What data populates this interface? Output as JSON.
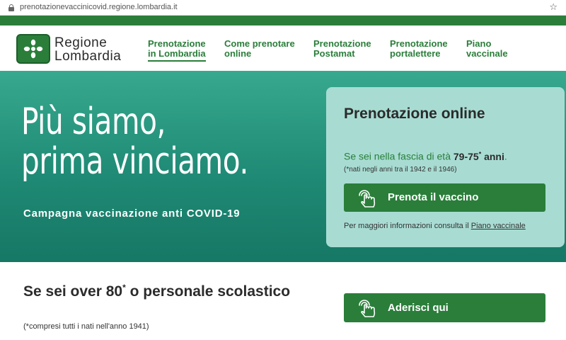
{
  "browser": {
    "url": "prenotazionevaccinicovid.regione.lombardia.it"
  },
  "header": {
    "logo_line1": "Regione",
    "logo_line2": "Lombardia",
    "nav": [
      {
        "line1": "Prenotazione",
        "line2": "in Lombardia",
        "active": true
      },
      {
        "line1": "Come prenotare",
        "line2": "online",
        "active": false
      },
      {
        "line1": "Prenotazione",
        "line2": "Postamat",
        "active": false
      },
      {
        "line1": "Prenotazione",
        "line2": "portalettere",
        "active": false
      },
      {
        "line1": "Piano",
        "line2": "vaccinale",
        "active": false
      }
    ]
  },
  "hero": {
    "title_line1": "Più siamo,",
    "title_line2": "prima vinciamo.",
    "subtitle": "Campagna vaccinazione anti COVID-19"
  },
  "booking_card": {
    "title": "Prenotazione online",
    "age_prefix": "Se sei nella fascia di età ",
    "age_range": "79-75",
    "age_asterisk": "*",
    "age_suffix": " anni",
    "age_period": ".",
    "note": "(*nati negli anni tra il 1942 e il 1946)",
    "button_label": "Prenota il vaccino",
    "info_text": "Per maggiori informazioni consulta il ",
    "info_link": "Piano vaccinale"
  },
  "over80": {
    "title_part1": "Se sei over 80",
    "title_asterisk": "*",
    "title_part2": " o personale scolastico",
    "note": "(*compresi tutti i nati nell'anno 1941)",
    "button_label": "Aderisci qui"
  },
  "colors": {
    "brand_green": "#2a7e3a",
    "hero_teal": "#1f8a75",
    "card_bg": "#a8dcd3"
  },
  "icons": {
    "lock": "lock-icon",
    "star": "star-icon",
    "logo": "lombardia-logo-icon",
    "hand": "touch-hand-icon"
  }
}
